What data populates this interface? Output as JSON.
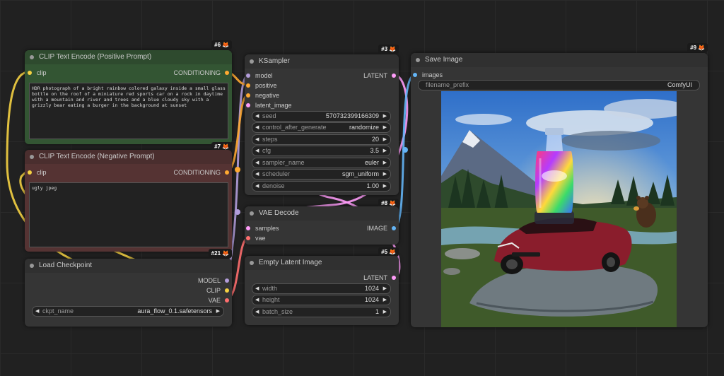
{
  "nodes": {
    "pos": {
      "badge": "#6",
      "title": "CLIP Text Encode (Positive Prompt)",
      "input": "clip",
      "output": "CONDITIONING",
      "text": "HDR photograph of a bright rainbow colored galaxy inside a small glass bottle on the roof of a miniature red sports car on a rock in daytime with a mountain and river and trees and a blue cloudy sky with a grizzly bear eating a burger in the background at sunset"
    },
    "neg": {
      "badge": "#7",
      "title": "CLIP Text Encode (Negative Prompt)",
      "input": "clip",
      "output": "CONDITIONING",
      "text": "ugly jpeg"
    },
    "ckpt": {
      "badge": "#21",
      "title": "Load Checkpoint",
      "outputs": [
        "MODEL",
        "CLIP",
        "VAE"
      ],
      "widget_label": "ckpt_name",
      "widget_value": "aura_flow_0.1.safetensors"
    },
    "ksampler": {
      "badge": "#3",
      "title": "KSampler",
      "inputs": [
        "model",
        "positive",
        "negative",
        "latent_image"
      ],
      "output": "LATENT",
      "widgets": [
        {
          "label": "seed",
          "value": "570732399166309"
        },
        {
          "label": "control_after_generate",
          "value": "randomize"
        },
        {
          "label": "steps",
          "value": "20"
        },
        {
          "label": "cfg",
          "value": "3.5"
        },
        {
          "label": "sampler_name",
          "value": "euler"
        },
        {
          "label": "scheduler",
          "value": "sgm_uniform"
        },
        {
          "label": "denoise",
          "value": "1.00"
        }
      ]
    },
    "vae": {
      "badge": "#8",
      "title": "VAE Decode",
      "inputs": [
        "samples",
        "vae"
      ],
      "output": "IMAGE"
    },
    "latent": {
      "badge": "#5",
      "title": "Empty Latent Image",
      "output": "LATENT",
      "widgets": [
        {
          "label": "width",
          "value": "1024"
        },
        {
          "label": "height",
          "value": "1024"
        },
        {
          "label": "batch_size",
          "value": "1"
        }
      ]
    },
    "save": {
      "badge": "#9",
      "title": "Save Image",
      "input": "images",
      "widget_label": "filename_prefix",
      "widget_value": "ComfyUI"
    }
  },
  "colors": {
    "clip": "#f5d142",
    "conditioning": "#ffa931",
    "model": "#b39ddb",
    "vae": "#ff6e6e",
    "latent": "#ff9cf9",
    "image": "#64b5f6",
    "positive_node_bg": "#335533",
    "negative_node_bg": "#553333"
  }
}
